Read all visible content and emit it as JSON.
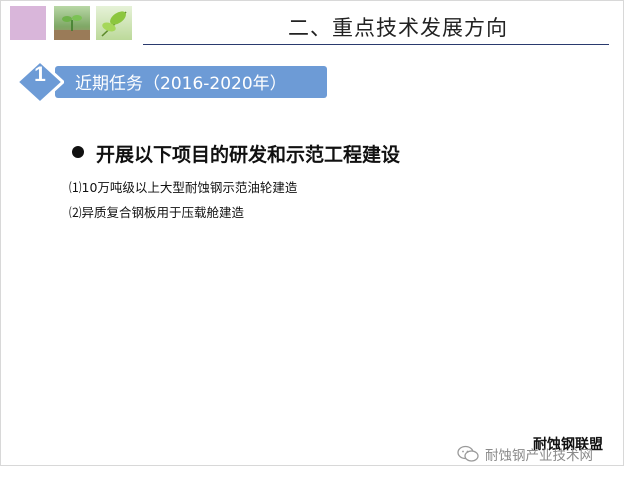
{
  "header": {
    "title": "二、重点技术发展方向"
  },
  "section": {
    "number": "1",
    "label": "近期任务（2016-2020年）"
  },
  "content": {
    "heading": "开展以下项目的研发和示范工程建设",
    "items": [
      "⑴10万吨级以上大型耐蚀钢示范油轮建造",
      "⑵异质复合钢板用于压载舱建造"
    ]
  },
  "footer": {
    "org": "耐蚀钢联盟",
    "watermark": "耐蚀钢产业技术网"
  },
  "colors": {
    "accent_blue": "#6d9bd6",
    "title_rule": "#2a3a6e",
    "square_pink": "#d9b6da"
  },
  "icons": [
    "seedling-image",
    "leaf-image",
    "wechat-icon"
  ]
}
